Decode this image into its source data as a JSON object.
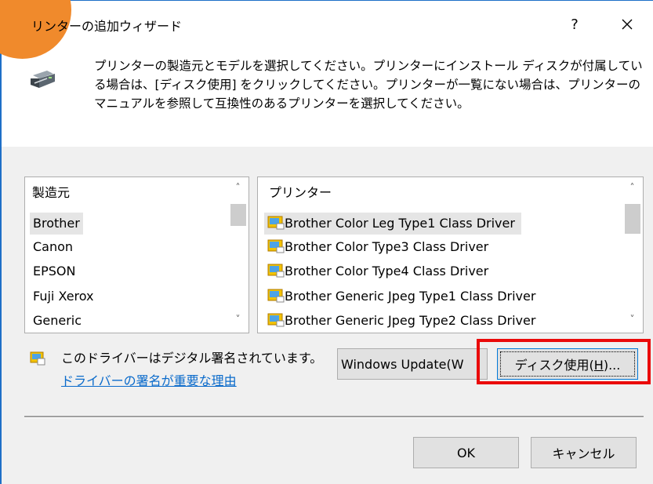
{
  "window": {
    "title": "リンターの追加ウィザード",
    "help_label": "?",
    "close_icon": "close-icon"
  },
  "header": {
    "icon": "printer-icon",
    "instructions": "プリンターの製造元とモデルを選択してください。プリンターにインストール ディスクが付属している場合は、[ディスク使用] をクリックしてください。プリンターが一覧にない場合は、プリンターのマニュアルを参照して互換性のあるプリンターを選択してください。"
  },
  "manufacturer_list": {
    "header": "製造元",
    "items": [
      "Brother",
      "Canon",
      "EPSON",
      "Fuji Xerox",
      "Generic"
    ],
    "selected": "Brother"
  },
  "printer_list": {
    "header": "プリンター",
    "items": [
      "Brother Color Leg Type1 Class Driver",
      "Brother Color Type3 Class Driver",
      "Brother Color Type4 Class Driver",
      "Brother Generic Jpeg Type1 Class Driver",
      "Brother Generic Jpeg Type2 Class Driver"
    ],
    "selected": "Brother Color Leg Type1 Class Driver"
  },
  "signature": {
    "text": "このドライバーはデジタル署名されています。",
    "link": "ドライバーの署名が重要な理由"
  },
  "buttons": {
    "windows_update": "Windows Update(W",
    "have_disk_prefix": "ディスク使用(",
    "have_disk_key": "H",
    "have_disk_suffix": ")...",
    "ok": "OK",
    "cancel": "キャンセル"
  },
  "colors": {
    "highlight": "#ea0a0a",
    "accent_circle": "#f08a2c",
    "link": "#0b6bcb"
  }
}
